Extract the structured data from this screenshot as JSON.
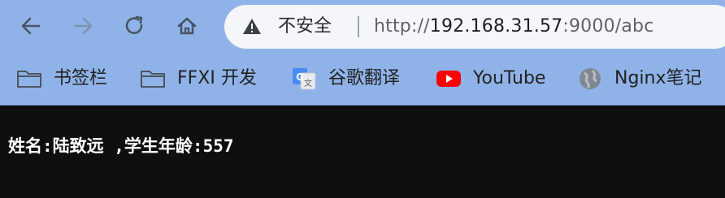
{
  "colors": {
    "chrome_bg": "#8fb3e8",
    "omnibox_bg": "#f4f6fa",
    "page_bg": "#0f0f0f",
    "page_text": "#ffffff",
    "youtube_red": "#ff0000"
  },
  "toolbar": {
    "back_icon": "arrow-left-icon",
    "forward_icon": "arrow-right-icon",
    "reload_icon": "reload-icon",
    "home_icon": "home-icon"
  },
  "omnibox": {
    "security_icon": "warning-triangle-icon",
    "security_label": "不安全",
    "url_scheme": "http://",
    "url_host": "192.168.31.57",
    "url_rest": ":9000/abc"
  },
  "bookmarks": [
    {
      "icon": "folder-icon",
      "label": "书签栏"
    },
    {
      "icon": "folder-icon",
      "label": "FFXI 开发"
    },
    {
      "icon": "google-translate-icon",
      "label": "谷歌翻译"
    },
    {
      "icon": "youtube-icon",
      "label": "YouTube"
    },
    {
      "icon": "globe-icon",
      "label": "Nginx笔记"
    }
  ],
  "page": {
    "content": "姓名:陆致远 ,学生年龄:557"
  }
}
